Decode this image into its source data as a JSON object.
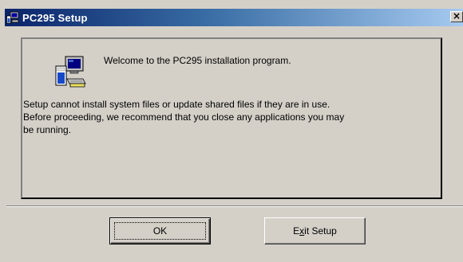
{
  "window": {
    "title": "PC295 Setup",
    "close_label": "×"
  },
  "content": {
    "welcome": "Welcome to the PC295 installation program.",
    "message_line1": "Setup cannot install system files or update shared files if they are in use.",
    "message_line2": "Before proceeding, we recommend that you close any applications you may",
    "message_line3": "be running."
  },
  "buttons": {
    "ok_label": "OK",
    "exit_prefix": "E",
    "exit_mnemonic": "x",
    "exit_suffix": "it Setup"
  },
  "icons": {
    "title": "setup-computer-icon",
    "main": "setup-computer-icon"
  },
  "colors": {
    "titlebar_start": "#0a246a",
    "titlebar_end": "#a6caf0",
    "face": "#d4d0c8"
  }
}
